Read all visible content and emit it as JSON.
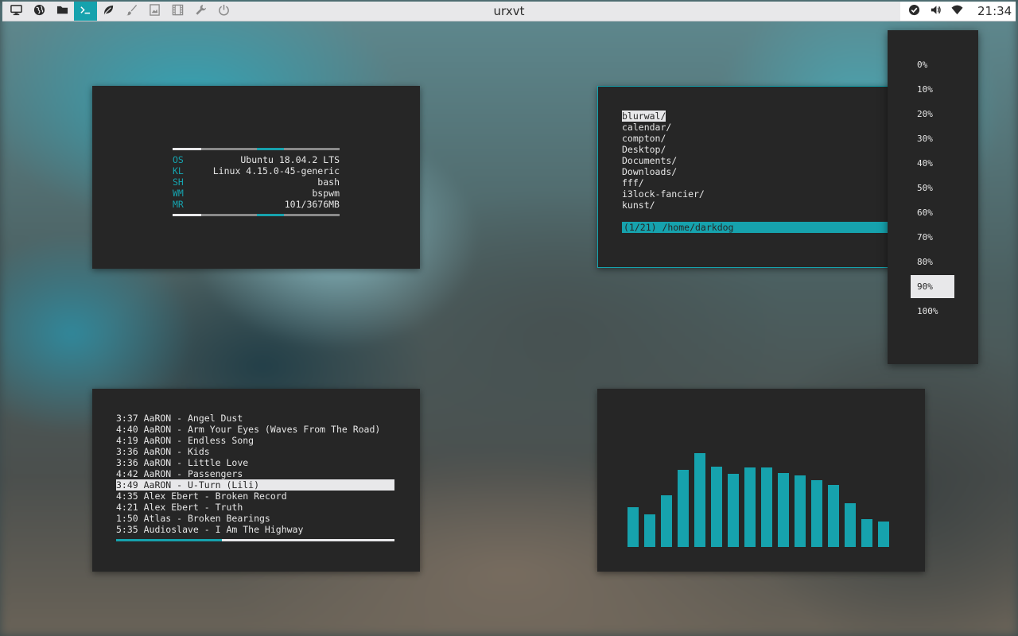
{
  "topbar": {
    "title": "urxvt",
    "clock": "21:34",
    "launchers": [
      {
        "icon": "monitor-icon",
        "state": "normal"
      },
      {
        "icon": "globe-icon",
        "state": "normal"
      },
      {
        "icon": "folder-icon",
        "state": "normal"
      },
      {
        "icon": "terminal-icon",
        "state": "active"
      },
      {
        "icon": "leaf-icon",
        "state": "normal"
      },
      {
        "icon": "brush-icon",
        "state": "dim"
      },
      {
        "icon": "image-icon",
        "state": "dim"
      },
      {
        "icon": "film-icon",
        "state": "dim"
      },
      {
        "icon": "wrench-icon",
        "state": "dim"
      },
      {
        "icon": "power-icon",
        "state": "dim"
      }
    ],
    "tray": [
      "check-circle-icon",
      "volume-icon",
      "wifi-icon"
    ]
  },
  "colors": {
    "accent": "#16a2ad",
    "window_bg": "#262626",
    "fg": "#e6e6e6",
    "bar_bg": "#e8e8ea"
  },
  "sysinfo": {
    "rows": [
      {
        "key": "OS",
        "value": "Ubuntu 18.04.2 LTS"
      },
      {
        "key": "KL",
        "value": "Linux 4.15.0-45-generic"
      },
      {
        "key": "SH",
        "value": "bash"
      },
      {
        "key": "WM",
        "value": "bspwm"
      },
      {
        "key": "MR",
        "value": "101/3676MB"
      }
    ]
  },
  "files": {
    "items": [
      "blurwal/",
      "calendar/",
      "compton/",
      "Desktop/",
      "Documents/",
      "Downloads/",
      "fff/",
      "i3lock-fancier/",
      "kunst/"
    ],
    "selected_index": 0,
    "status": "(1/21) /home/darkdog"
  },
  "volume_menu": {
    "options": [
      "0%",
      "10%",
      "20%",
      "30%",
      "40%",
      "50%",
      "60%",
      "70%",
      "80%",
      "90%",
      "100%"
    ],
    "selected_index": 9
  },
  "playlist": {
    "tracks": [
      "3:37 AaRON - Angel Dust",
      "4:40 AaRON - Arm Your Eyes (Waves From The Road)",
      "4:19 AaRON - Endless Song",
      "3:36 AaRON - Kids",
      "3:36 AaRON - Little Love",
      "4:42 AaRON - Passengers",
      "3:49 AaRON - U-Turn (Lili)",
      "4:35 Alex Ebert - Broken Record",
      "4:21 Alex Ebert - Truth",
      "1:50 Atlas - Broken Bearings",
      "5:35 Audioslave - I Am The Highway"
    ],
    "current_index": 6,
    "progress": 0.38
  },
  "visualizer": {
    "levels": [
      0.42,
      0.35,
      0.55,
      0.82,
      1.0,
      0.86,
      0.78,
      0.85,
      0.85,
      0.79,
      0.76,
      0.71,
      0.66,
      0.47,
      0.3,
      0.27
    ]
  }
}
